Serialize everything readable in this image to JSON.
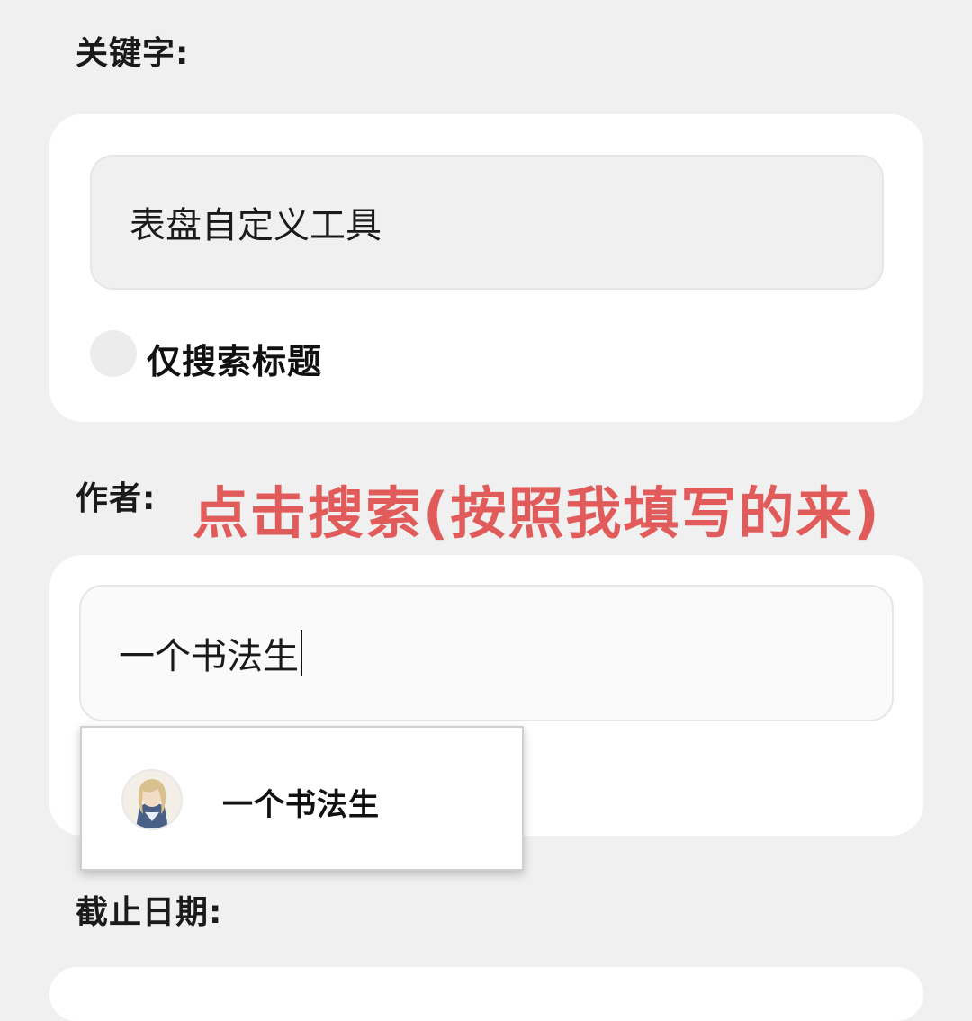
{
  "keyword": {
    "label": "关键字:",
    "value": "表盘自定义工具",
    "title_only_label": "仅搜索标题"
  },
  "author": {
    "label": "作者:",
    "value": "一个书法生",
    "suggestion": {
      "name": "一个书法生"
    }
  },
  "annotation": "点击搜索(按照我填写的来)",
  "deadline": {
    "label": "截止日期:"
  }
}
